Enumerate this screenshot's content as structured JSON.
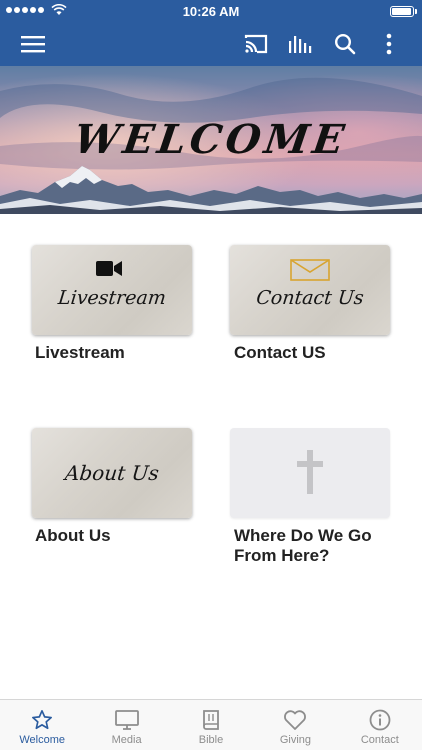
{
  "status_bar": {
    "time": "10:26 AM"
  },
  "header": {
    "icons": [
      "menu-icon",
      "cast-icon",
      "audio-bars-icon",
      "search-icon",
      "more-vertical-icon"
    ],
    "accent_color": "#2b5c9f"
  },
  "hero": {
    "title": "WELCOME"
  },
  "tiles": [
    {
      "image_text": "Livestream",
      "caption": "Livestream",
      "icon": "video-camera-icon"
    },
    {
      "image_text": "Contact Us",
      "caption": "Contact US",
      "icon": "envelope-icon"
    },
    {
      "image_text": "About Us",
      "caption": "About Us",
      "icon": ""
    },
    {
      "image_text": "",
      "caption_line1": "Where Do We Go",
      "caption_line2": "From Here?",
      "icon": "cross-icon"
    }
  ],
  "tabbar": {
    "items": [
      {
        "label": "Welcome",
        "icon": "star-icon",
        "active": true
      },
      {
        "label": "Media",
        "icon": "tv-icon",
        "active": false
      },
      {
        "label": "Bible",
        "icon": "book-icon",
        "active": false
      },
      {
        "label": "Giving",
        "icon": "heart-icon",
        "active": false
      },
      {
        "label": "Contact",
        "icon": "info-icon",
        "active": false
      }
    ]
  }
}
